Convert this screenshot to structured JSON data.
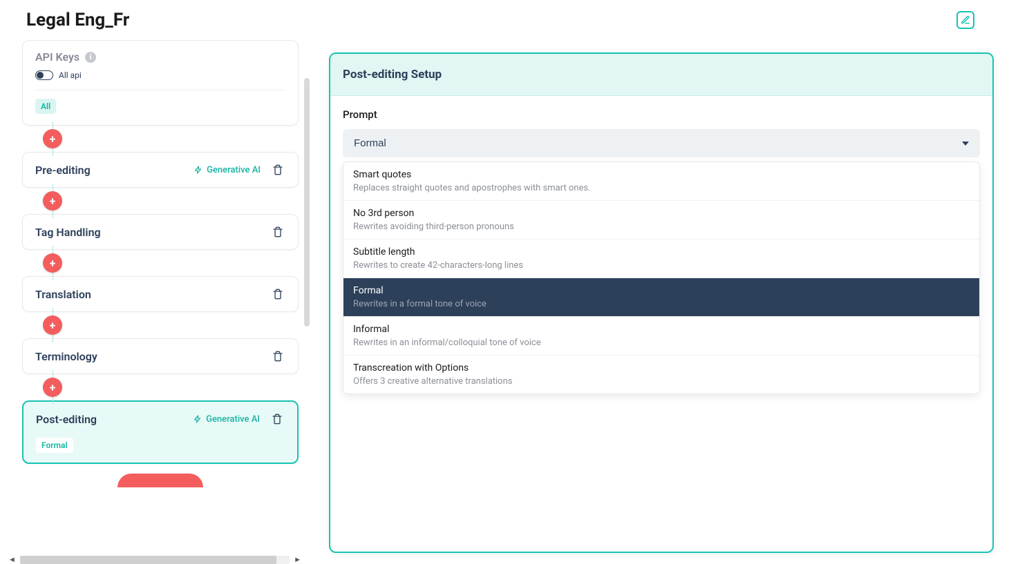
{
  "header": {
    "title": "Legal Eng_Fr"
  },
  "left": {
    "api_card": {
      "title": "API Keys",
      "toggle_label": "All api",
      "chip": "All"
    },
    "steps": [
      {
        "title": "Pre-editing",
        "gen_ai": "Generative AI",
        "has_gen": true,
        "active": false
      },
      {
        "title": "Tag Handling",
        "has_gen": false,
        "active": false
      },
      {
        "title": "Translation",
        "has_gen": false,
        "active": false
      },
      {
        "title": "Terminology",
        "has_gen": false,
        "active": false
      },
      {
        "title": "Post-editing",
        "gen_ai": "Generative AI",
        "has_gen": true,
        "active": true,
        "chip": "Formal"
      }
    ]
  },
  "panel": {
    "title": "Post-editing Setup",
    "prompt_label": "Prompt",
    "select_value": "Formal",
    "options": [
      {
        "title": "Smart quotes",
        "desc": "Replaces straight quotes and apostrophes with smart ones.",
        "selected": false
      },
      {
        "title": "No 3rd person",
        "desc": "Rewrites avoiding third-person pronouns",
        "selected": false
      },
      {
        "title": "Subtitle length",
        "desc": "Rewrites to create 42-characters-long lines",
        "selected": false
      },
      {
        "title": "Formal",
        "desc": "Rewrites in a formal tone of voice",
        "selected": true
      },
      {
        "title": "Informal",
        "desc": "Rewrites in an informal/colloquial tone of voice",
        "selected": false
      },
      {
        "title": "Transcreation with Options",
        "desc": "Offers 3 creative alternative translations",
        "selected": false
      }
    ]
  }
}
